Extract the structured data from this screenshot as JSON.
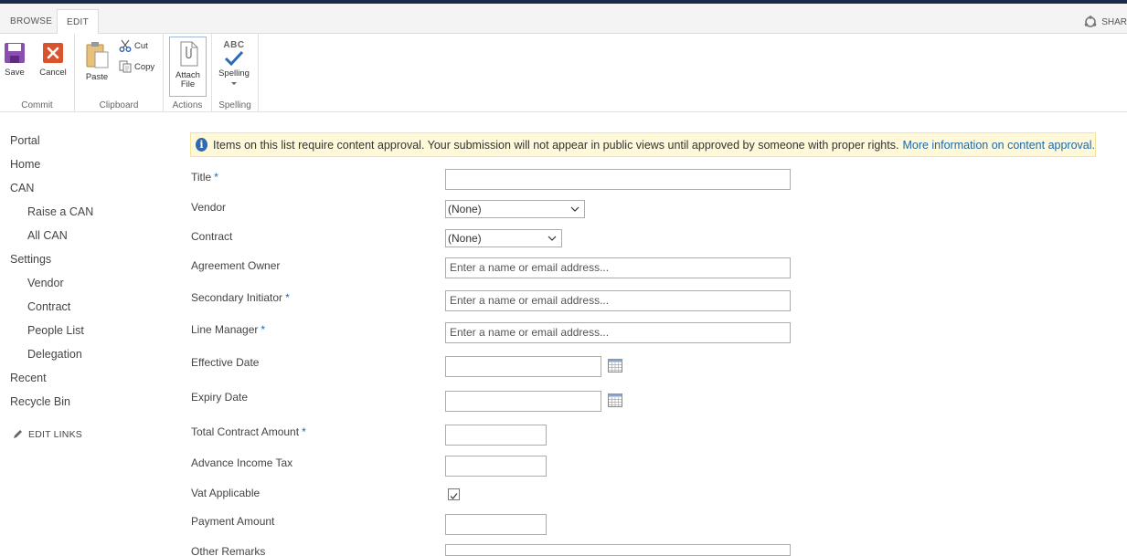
{
  "tabs": {
    "browse": "BROWSE",
    "edit": "EDIT",
    "share": "SHAR"
  },
  "ribbon": {
    "commit": {
      "group": "Commit",
      "save": "Save",
      "cancel": "Cancel"
    },
    "clipboard": {
      "group": "Clipboard",
      "paste": "Paste",
      "cut": "Cut",
      "copy": "Copy"
    },
    "actions": {
      "group": "Actions",
      "attach_line1": "Attach",
      "attach_line2": "File"
    },
    "spelling": {
      "group": "Spelling",
      "label": "Spelling",
      "icon_text": "ABC"
    }
  },
  "nav": {
    "items": [
      "Portal",
      "Home",
      "CAN",
      "Raise a CAN",
      "All CAN",
      "Settings",
      "Vendor",
      "Contract",
      "People List",
      "Delegation",
      "Recent",
      "Recycle Bin"
    ],
    "edit_links": "EDIT LINKS"
  },
  "notice": {
    "text": "Items on this list require content approval. Your submission will not appear in public views until approved by someone with proper rights.",
    "link": "More information on content approval."
  },
  "form": {
    "title": {
      "label": "Title",
      "required": "*",
      "value": ""
    },
    "vendor": {
      "label": "Vendor",
      "value": "(None)"
    },
    "contract": {
      "label": "Contract",
      "value": "(None)"
    },
    "agreement_owner": {
      "label": "Agreement Owner",
      "placeholder": "Enter a name or email address..."
    },
    "secondary_initiator": {
      "label": "Secondary Initiator",
      "required": "*",
      "placeholder": "Enter a name or email address..."
    },
    "line_manager": {
      "label": "Line Manager",
      "required": "*",
      "placeholder": "Enter a name or email address..."
    },
    "effective_date": {
      "label": "Effective Date",
      "value": ""
    },
    "expiry_date": {
      "label": "Expiry Date",
      "value": ""
    },
    "total_contract_amount": {
      "label": "Total Contract Amount",
      "required": "*",
      "value": ""
    },
    "advance_income_tax": {
      "label": "Advance Income Tax",
      "value": ""
    },
    "vat_applicable": {
      "label": "Vat Applicable",
      "checked": true
    },
    "payment_amount": {
      "label": "Payment Amount",
      "value": ""
    },
    "other_remarks": {
      "label": "Other Remarks",
      "value": ""
    }
  },
  "colors": {
    "accent": "#1a6aad",
    "save_icon": "#8a4db0",
    "cancel_icon": "#d9532c",
    "notice_bg": "#fff8d9"
  }
}
